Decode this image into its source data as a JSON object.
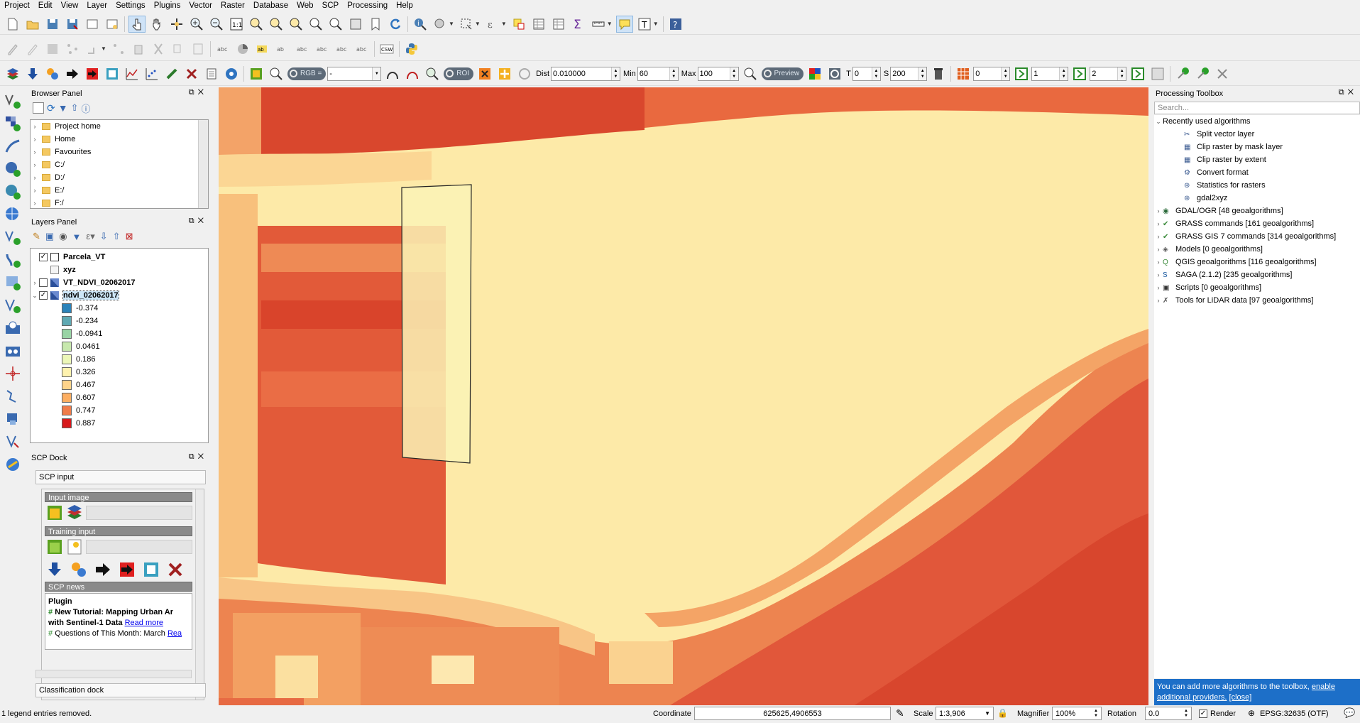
{
  "menus": [
    "Project",
    "Edit",
    "View",
    "Layer",
    "Settings",
    "Plugins",
    "Vector",
    "Raster",
    "Database",
    "Web",
    "SCP",
    "Processing",
    "Help"
  ],
  "scp_toolbar": {
    "rgb_label": "RGB =",
    "rgb_value": "-",
    "roi_label": "ROI",
    "dist_label": "Dist",
    "dist_value": "0.010000",
    "min_label": "Min",
    "min_value": "60",
    "max_label": "Max",
    "max_value": "100",
    "preview_label": "Preview",
    "t_label": "T",
    "t_value": "0",
    "s_label": "S",
    "s_value": "200",
    "band_a": "0",
    "band_b": "1",
    "band_c": "2"
  },
  "browser": {
    "title": "Browser Panel",
    "items": [
      "Project home",
      "Home",
      "Favourites",
      "C:/",
      "D:/",
      "E:/",
      "F:/"
    ]
  },
  "layers": {
    "title": "Layers Panel",
    "items": [
      {
        "name": "Parcela_VT",
        "checked": true
      },
      {
        "name": "xyz",
        "checked": false
      },
      {
        "name": "VT_NDVI_02062017",
        "checked": false
      },
      {
        "name": "ndvi_02062017",
        "checked": true
      }
    ],
    "legend": [
      {
        "value": "-0.374",
        "color": "#2b83ba"
      },
      {
        "value": "-0.234",
        "color": "#5fa9b3"
      },
      {
        "value": "-0.0941",
        "color": "#99d4a5"
      },
      {
        "value": "0.0461",
        "color": "#c7e8ad"
      },
      {
        "value": "0.186",
        "color": "#ecf7b8"
      },
      {
        "value": "0.326",
        "color": "#fef2ae"
      },
      {
        "value": "0.467",
        "color": "#fed38a"
      },
      {
        "value": "0.607",
        "color": "#fdae61"
      },
      {
        "value": "0.747",
        "color": "#f07c4a"
      },
      {
        "value": "0.887",
        "color": "#d7191c"
      }
    ]
  },
  "scp": {
    "title": "SCP Dock",
    "tab": "SCP input",
    "input_image": "Input image",
    "training_input": "Training input",
    "news": "SCP news",
    "news_heading": "Plugin",
    "news1": "New Tutorial: Mapping Urban Ar",
    "news1b": "with Sentinel-1 Data",
    "read_more": "Read more",
    "news2": "Questions of This Month: March",
    "news2_link": "Rea",
    "bottom_tab": "Classification dock"
  },
  "processing": {
    "title": "Processing Toolbox",
    "search_placeholder": "Search...",
    "recent_label": "Recently used algorithms",
    "recent": [
      "Split vector layer",
      "Clip raster by mask layer",
      "Clip raster by extent",
      "Convert format",
      "Statistics for rasters",
      "gdal2xyz"
    ],
    "providers": [
      "GDAL/OGR [48 geoalgorithms]",
      "GRASS commands [161 geoalgorithms]",
      "GRASS GIS 7 commands [314 geoalgorithms]",
      "Models [0 geoalgorithms]",
      "QGIS geoalgorithms [116 geoalgorithms]",
      "SAGA (2.1.2) [235 geoalgorithms]",
      "Scripts [0 geoalgorithms]",
      "Tools for LiDAR data [97 geoalgorithms]"
    ],
    "info_text": "You can add more algorithms to the toolbox,",
    "info_link": "enable additional providers.",
    "info_close": "[close]"
  },
  "status": {
    "message": "1 legend entries removed.",
    "coordinate_label": "Coordinate",
    "coordinate": "625625,4906553",
    "scale_label": "Scale",
    "scale": "1:3,906",
    "magnifier_label": "Magnifier",
    "magnifier": "100%",
    "rotation_label": "Rotation",
    "rotation": "0.0",
    "render_label": "Render",
    "crs": "EPSG:32635 (OTF)"
  }
}
